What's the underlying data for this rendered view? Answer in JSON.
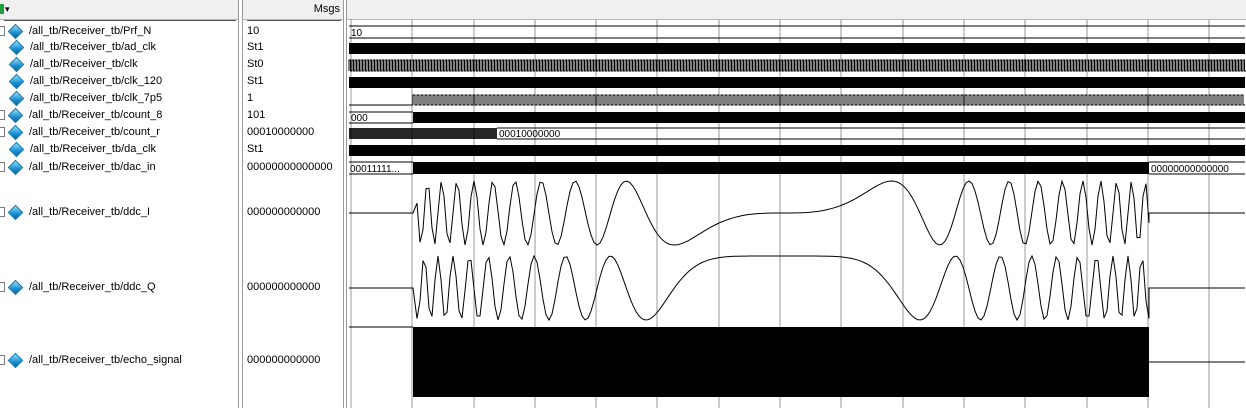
{
  "header": {
    "msgs_label": "Msgs",
    "menu_icon": "dropdown-arrow-icon",
    "menu_arrow": "▾"
  },
  "signals": [
    {
      "name": "/all_tb/Receiver_tb/Prf_N",
      "value": "10",
      "expandable": true
    },
    {
      "name": "/all_tb/Receiver_tb/ad_clk",
      "value": "St1",
      "expandable": false
    },
    {
      "name": "/all_tb/Receiver_tb/clk",
      "value": "St0",
      "expandable": false
    },
    {
      "name": "/all_tb/Receiver_tb/clk_120",
      "value": "St1",
      "expandable": false
    },
    {
      "name": "/all_tb/Receiver_tb/clk_7p5",
      "value": "1",
      "expandable": false
    },
    {
      "name": "/all_tb/Receiver_tb/count_8",
      "value": "101",
      "expandable": true
    },
    {
      "name": "/all_tb/Receiver_tb/count_r",
      "value": "00010000000",
      "expandable": true
    },
    {
      "name": "/all_tb/Receiver_tb/da_clk",
      "value": "St1",
      "expandable": false
    },
    {
      "name": "/all_tb/Receiver_tb/dac_in",
      "value": "00000000000000",
      "expandable": true
    },
    {
      "name": "/all_tb/Receiver_tb/ddc_I",
      "value": "000000000000",
      "expandable": true
    },
    {
      "name": "/all_tb/Receiver_tb/ddc_Q",
      "value": "000000000000",
      "expandable": true
    },
    {
      "name": "/all_tb/Receiver_tb/echo_signal",
      "value": "000000000000",
      "expandable": true
    }
  ],
  "wave_labels": {
    "prf_n": "10",
    "count_8_start": "000",
    "count_r_end": "00010000000",
    "dac_in_start": "00011111...",
    "dac_in_end": "00000000000000"
  },
  "colors": {
    "background": "#ffffff",
    "header": "#f0f0f0",
    "icon": "#1a8fd0",
    "wave": "#000000",
    "grid": "#8c8c8c"
  }
}
